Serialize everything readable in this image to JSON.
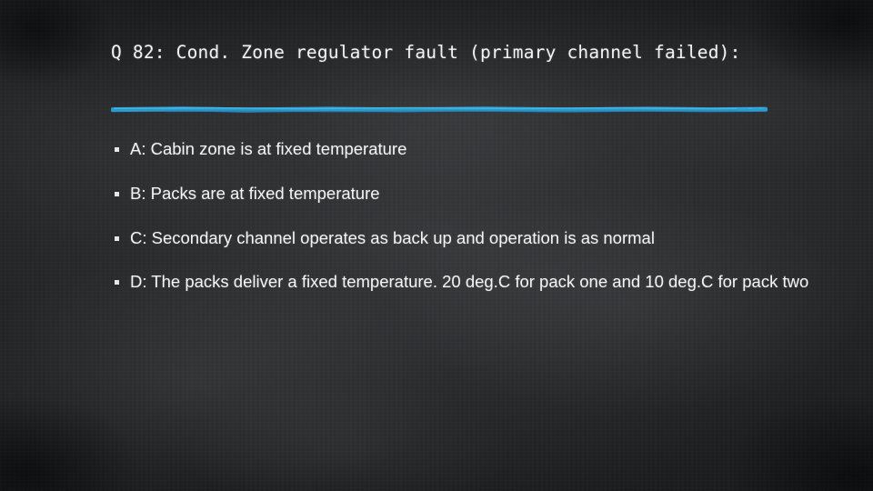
{
  "slide": {
    "title": "Q 82: Cond. Zone regulator fault (primary channel failed):",
    "divider_color": "#2a9fd6",
    "background_color": "#232426",
    "text_color": "#f3f5f7",
    "bullet_glyph": "▪",
    "answers": [
      {
        "label": "A: Cabin zone is at fixed temperature"
      },
      {
        "label": "B: Packs are at fixed temperature"
      },
      {
        "label": "C: Secondary channel operates as back up and operation is as normal"
      },
      {
        "label": "D: The packs deliver a fixed temperature. 20 deg.C for pack one and 10 deg.C for pack two"
      }
    ]
  }
}
